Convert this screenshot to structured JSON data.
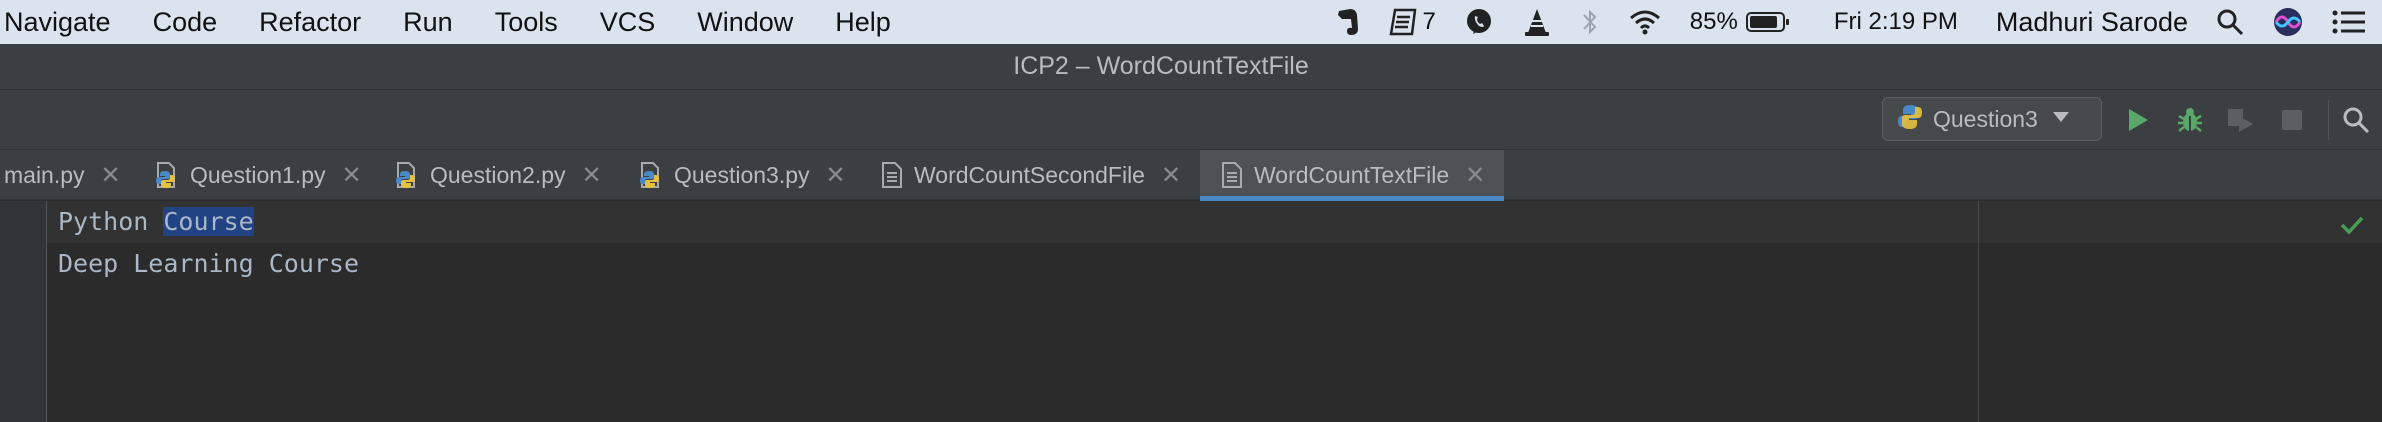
{
  "menubar": {
    "items": [
      "Navigate",
      "Code",
      "Refactor",
      "Run",
      "Tools",
      "VCS",
      "Window",
      "Help"
    ],
    "status": {
      "badge_count": "7",
      "battery": "85%",
      "clock": "Fri 2:19 PM",
      "user": "Madhuri Sarode"
    }
  },
  "window": {
    "title": "ICP2 – WordCountTextFile"
  },
  "toolbar": {
    "run_config": "Question3"
  },
  "tabs": [
    {
      "label": "main.py",
      "type": "python"
    },
    {
      "label": "Question1.py",
      "type": "python"
    },
    {
      "label": "Question2.py",
      "type": "python"
    },
    {
      "label": "Question3.py",
      "type": "python"
    },
    {
      "label": "WordCountSecondFile",
      "type": "text"
    },
    {
      "label": "WordCountTextFile",
      "type": "text",
      "active": true
    }
  ],
  "editor": {
    "lines": [
      {
        "before": "Python ",
        "selected": "Course"
      },
      {
        "text": "Deep Learning Course"
      }
    ]
  },
  "colors": {
    "accent": "#4a88c7",
    "selection": "#214283",
    "run_green": "#59a869",
    "check_green": "#499c54"
  }
}
